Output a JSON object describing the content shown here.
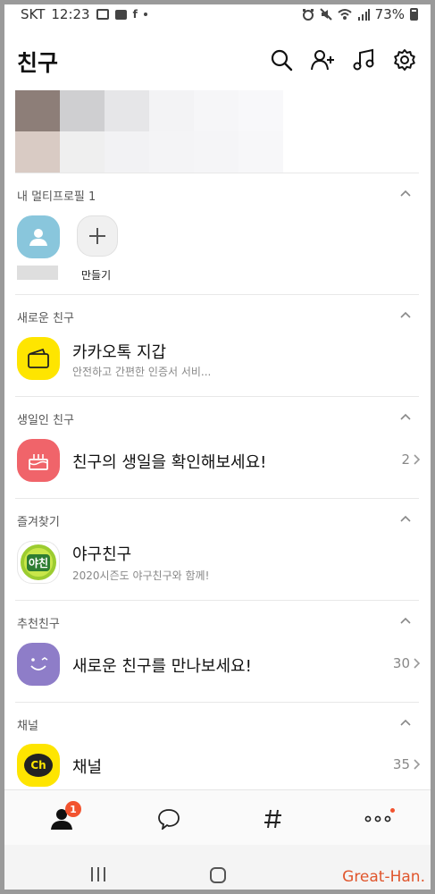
{
  "status_bar": {
    "carrier": "SKT",
    "time": "12:23",
    "battery": "73%"
  },
  "header": {
    "title": "친구",
    "icons": [
      "search-icon",
      "add-friend-icon",
      "music-icon",
      "settings-icon"
    ]
  },
  "multi_profile": {
    "title": "내 멀티프로필 1",
    "create_label": "만들기"
  },
  "sections": {
    "new_friends": {
      "title": "새로운 친구",
      "item_name": "카카오톡 지갑",
      "item_sub": "안전하고 간편한 인증서 서비..."
    },
    "birthday": {
      "title": "생일인 친구",
      "item_name": "친구의 생일을 확인해보세요!",
      "count": "2"
    },
    "favorites": {
      "title": "즐겨찾기",
      "item_name": "야구친구",
      "item_sub": "2020시즌도 야구친구와 함께!",
      "avatar_text": "야친"
    },
    "recommended": {
      "title": "추천친구",
      "item_name": "새로운 친구를 만나보세요!",
      "count": "30"
    },
    "channel": {
      "title": "채널",
      "item_name": "채널",
      "count": "35",
      "avatar_text": "Ch"
    }
  },
  "bottom_nav": {
    "badge": "1",
    "items": [
      "friends-tab",
      "chats-tab",
      "hashtag-tab",
      "more-tab"
    ]
  },
  "watermark": "Great-Han.",
  "colors": {
    "kakao_yellow": "#fee500",
    "birthday_red": "#f0646a",
    "recommend_purple": "#8e7dc8",
    "profile_blue": "#89c6dc",
    "badge_orange": "#f2532f"
  }
}
